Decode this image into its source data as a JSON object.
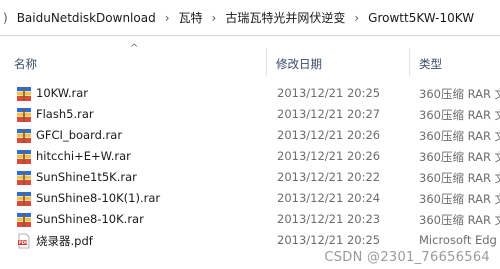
{
  "address_bar": {
    "segments": [
      "BaiduNetdiskDownload",
      "瓦特",
      "古瑞瓦特光并网伏逆变",
      "Growtt5KW-10KW"
    ],
    "leading_glyph": ")"
  },
  "columns": {
    "name": "名称",
    "modified": "修改日期",
    "type": "类型"
  },
  "files": [
    {
      "name": "10KW.rar",
      "modified": "2013/12/21 20:25",
      "type": "360压缩 RAR 文",
      "icon": "rar-archive-icon"
    },
    {
      "name": "Flash5.rar",
      "modified": "2013/12/21 20:27",
      "type": "360压缩 RAR 文",
      "icon": "rar-archive-icon"
    },
    {
      "name": "GFCI_board.rar",
      "modified": "2013/12/21 20:26",
      "type": "360压缩 RAR 文",
      "icon": "rar-archive-icon"
    },
    {
      "name": "hitcchi+E+W.rar",
      "modified": "2013/12/21 20:26",
      "type": "360压缩 RAR 文",
      "icon": "rar-archive-icon"
    },
    {
      "name": "SunShine1t5K.rar",
      "modified": "2013/12/21 20:22",
      "type": "360压缩 RAR 文",
      "icon": "rar-archive-icon"
    },
    {
      "name": "SunShine8-10K(1).rar",
      "modified": "2013/12/21 20:24",
      "type": "360压缩 RAR 文",
      "icon": "rar-archive-icon"
    },
    {
      "name": "SunShine8-10K.rar",
      "modified": "2013/12/21 20:23",
      "type": "360压缩 RAR 文",
      "icon": "rar-archive-icon"
    },
    {
      "name": "烧录器.pdf",
      "modified": "2013/12/21 20:25",
      "type": "Microsoft Edg",
      "icon": "pdf-document-icon"
    }
  ],
  "watermark": "CSDN @2301_76656564",
  "colors": {
    "rar_blue": "#2b6fd6",
    "rar_yellow": "#f2c14e",
    "rar_red": "#d94a3a",
    "pdf_red": "#d9342b"
  }
}
